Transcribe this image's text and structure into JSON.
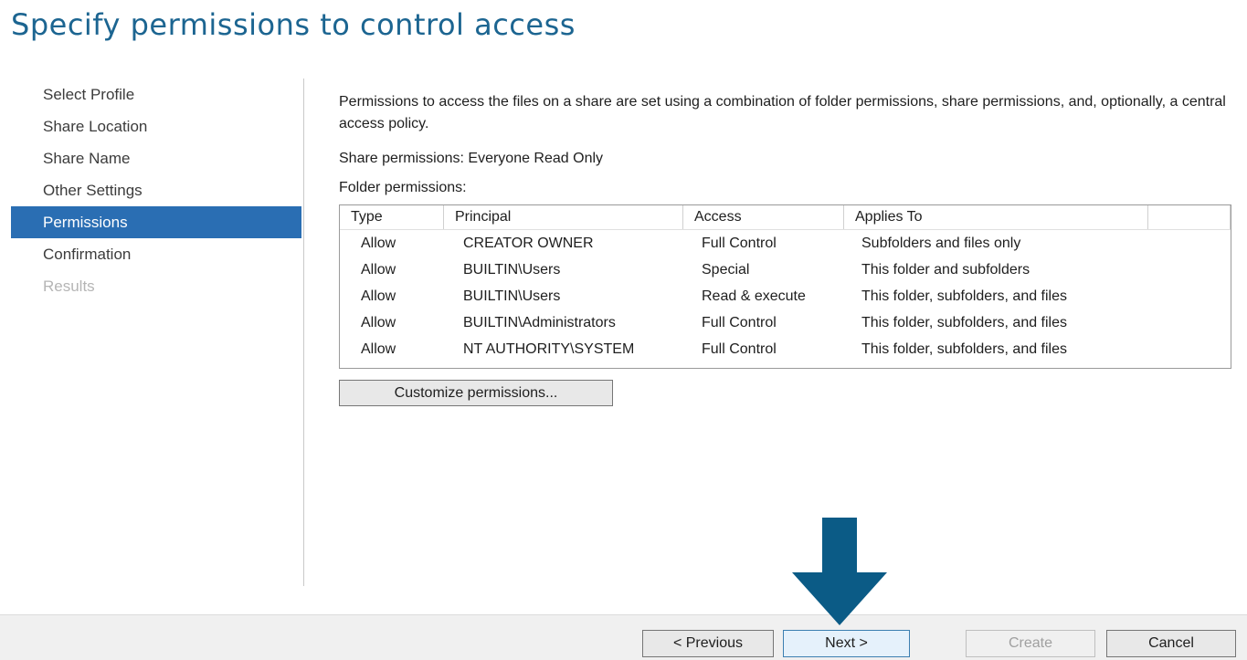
{
  "page": {
    "title": "Specify permissions to control access"
  },
  "sidebar": {
    "items": [
      {
        "label": "Select Profile",
        "state": "normal"
      },
      {
        "label": "Share Location",
        "state": "normal"
      },
      {
        "label": "Share Name",
        "state": "normal"
      },
      {
        "label": "Other Settings",
        "state": "normal"
      },
      {
        "label": "Permissions",
        "state": "active"
      },
      {
        "label": "Confirmation",
        "state": "normal"
      },
      {
        "label": "Results",
        "state": "disabled"
      }
    ]
  },
  "main": {
    "intro": "Permissions to access the files on a share are set using a combination of folder permissions, share permissions, and, optionally, a central access policy.",
    "share_permissions": "Share permissions: Everyone Read Only",
    "folder_permissions_label": "Folder permissions:",
    "table": {
      "columns": [
        "Type",
        "Principal",
        "Access",
        "Applies To"
      ],
      "rows": [
        {
          "type": "Allow",
          "principal": "CREATOR OWNER",
          "access": "Full Control",
          "applies_to": "Subfolders and files only"
        },
        {
          "type": "Allow",
          "principal": "BUILTIN\\Users",
          "access": "Special",
          "applies_to": "This folder and subfolders"
        },
        {
          "type": "Allow",
          "principal": "BUILTIN\\Users",
          "access": "Read & execute",
          "applies_to": "This folder, subfolders, and files"
        },
        {
          "type": "Allow",
          "principal": "BUILTIN\\Administrators",
          "access": "Full Control",
          "applies_to": "This folder, subfolders, and files"
        },
        {
          "type": "Allow",
          "principal": "NT AUTHORITY\\SYSTEM",
          "access": "Full Control",
          "applies_to": "This folder, subfolders, and files"
        }
      ]
    },
    "customize_button": "Customize permissions..."
  },
  "footer": {
    "previous_label": "< Previous",
    "next_label": "Next >",
    "create_label": "Create",
    "cancel_label": "Cancel"
  },
  "colors": {
    "title": "#1c6591",
    "sidebar_active": "#2a6eb3",
    "arrow": "#0b5b86"
  },
  "icons": {
    "annotation": "down-arrow-icon"
  }
}
